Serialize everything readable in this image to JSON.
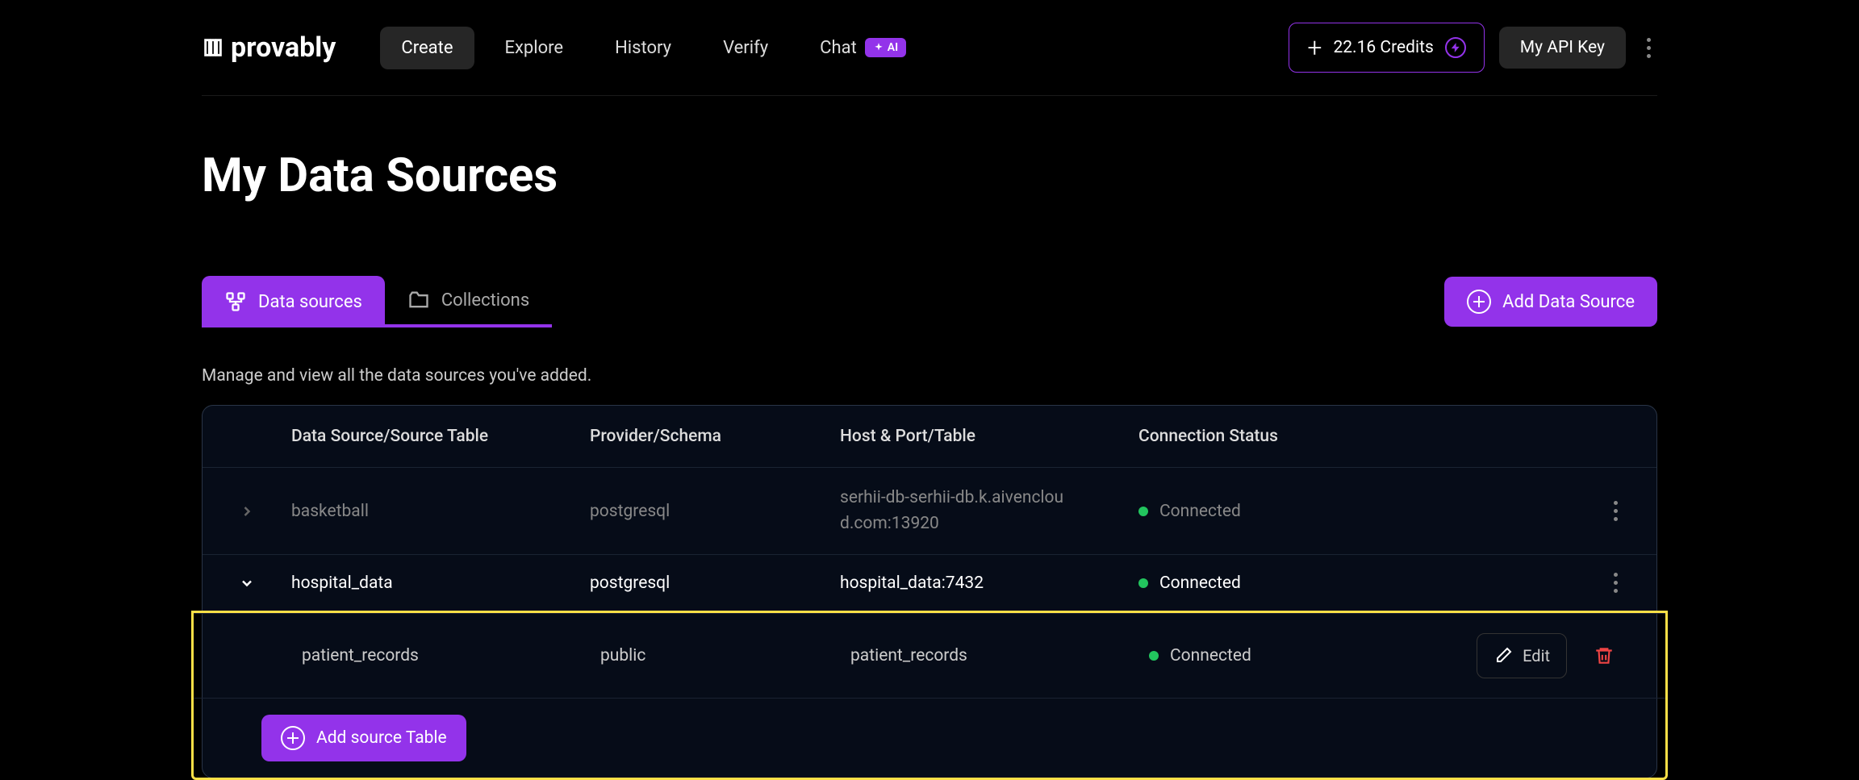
{
  "brand": "provably",
  "nav": {
    "create": "Create",
    "explore": "Explore",
    "history": "History",
    "verify": "Verify",
    "chat": "Chat",
    "ai_badge": "AI"
  },
  "header": {
    "credits": "22.16 Credits",
    "api_key": "My API Key"
  },
  "page": {
    "title": "My Data Sources",
    "subtitle": "Manage and view all the data sources you've added."
  },
  "tabs": {
    "data_sources": "Data sources",
    "collections": "Collections"
  },
  "buttons": {
    "add_source": "Add Data Source",
    "add_table": "Add source Table",
    "edit": "Edit"
  },
  "columns": {
    "name": "Data Source/Source Table",
    "provider": "Provider/Schema",
    "host": "Host & Port/Table",
    "status": "Connection Status"
  },
  "rows": [
    {
      "name": "basketball",
      "provider": "postgresql",
      "host": "serhii-db-serhii-db.k.aivencloud.com:13920",
      "status": "Connected",
      "expanded": false
    },
    {
      "name": "hospital_data",
      "provider": "postgresql",
      "host": "hospital_data:7432",
      "status": "Connected",
      "expanded": true,
      "tables": [
        {
          "name": "patient_records",
          "schema": "public",
          "table": "patient_records",
          "status": "Connected"
        }
      ]
    }
  ],
  "colors": {
    "accent": "#9333ea",
    "success": "#22c55e",
    "highlight": "#fde047"
  }
}
